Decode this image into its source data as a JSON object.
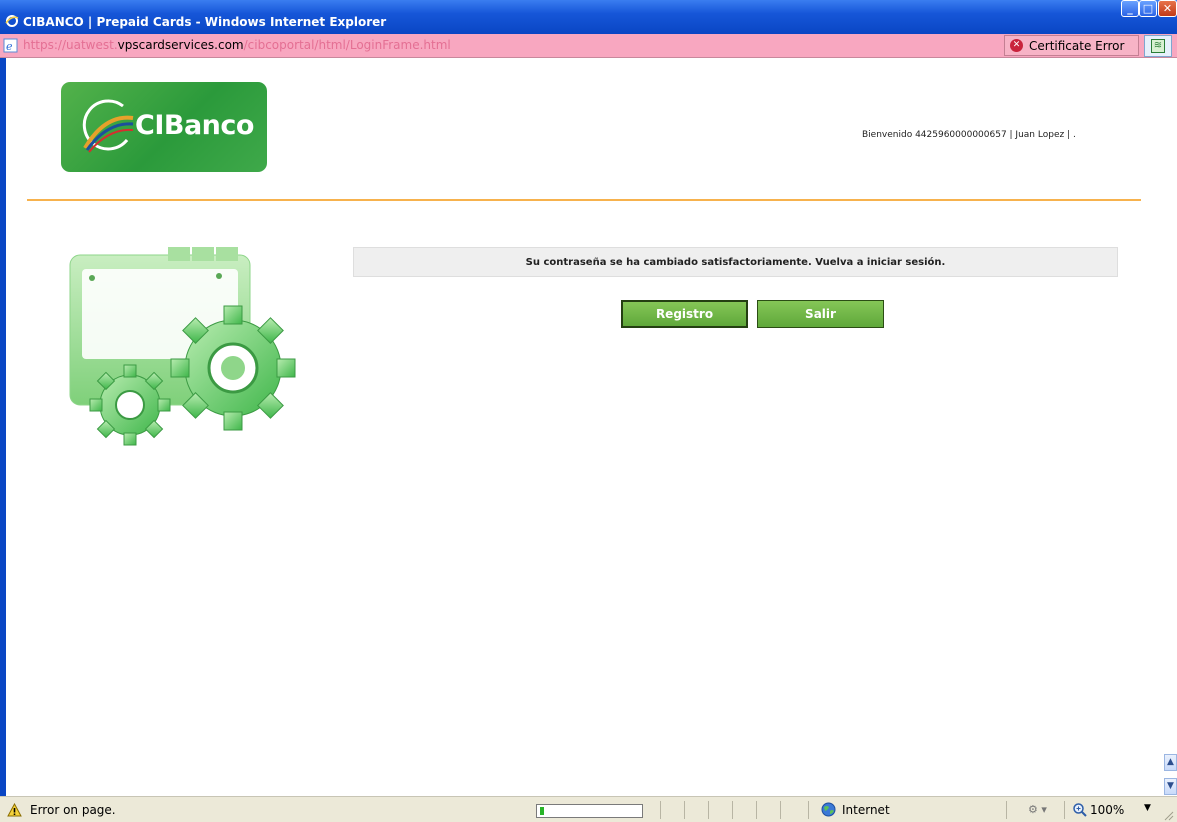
{
  "window": {
    "title": "CIBANCO | Prepaid Cards - Windows Internet Explorer",
    "buttons": {
      "minimize": "_",
      "maximize": "□",
      "close": "✕"
    }
  },
  "address_bar": {
    "url_prefix": "https://uatwest.",
    "url_domain": "vpscardservices.com",
    "url_path": "/cibcoportal/html/LoginFrame.html",
    "certificate_error": "Certificate Error"
  },
  "page": {
    "logo_text": "CIBanco",
    "welcome": "Bienvenido 4425960000000657 | Juan Lopez | .",
    "message": "Su contraseña se ha cambiado satisfactoriamente. Vuelva a iniciar sesión.",
    "buttons": {
      "registro": "Registro",
      "salir": "Salir"
    }
  },
  "status_bar": {
    "text": "Error on page.",
    "zone": "Internet",
    "zoom": "100%"
  },
  "colors": {
    "titlebar": "#0a46c4",
    "address_error_bg": "#f8a7c0",
    "accent_orange": "#f7b24d",
    "button_green": "#5fa83a"
  }
}
